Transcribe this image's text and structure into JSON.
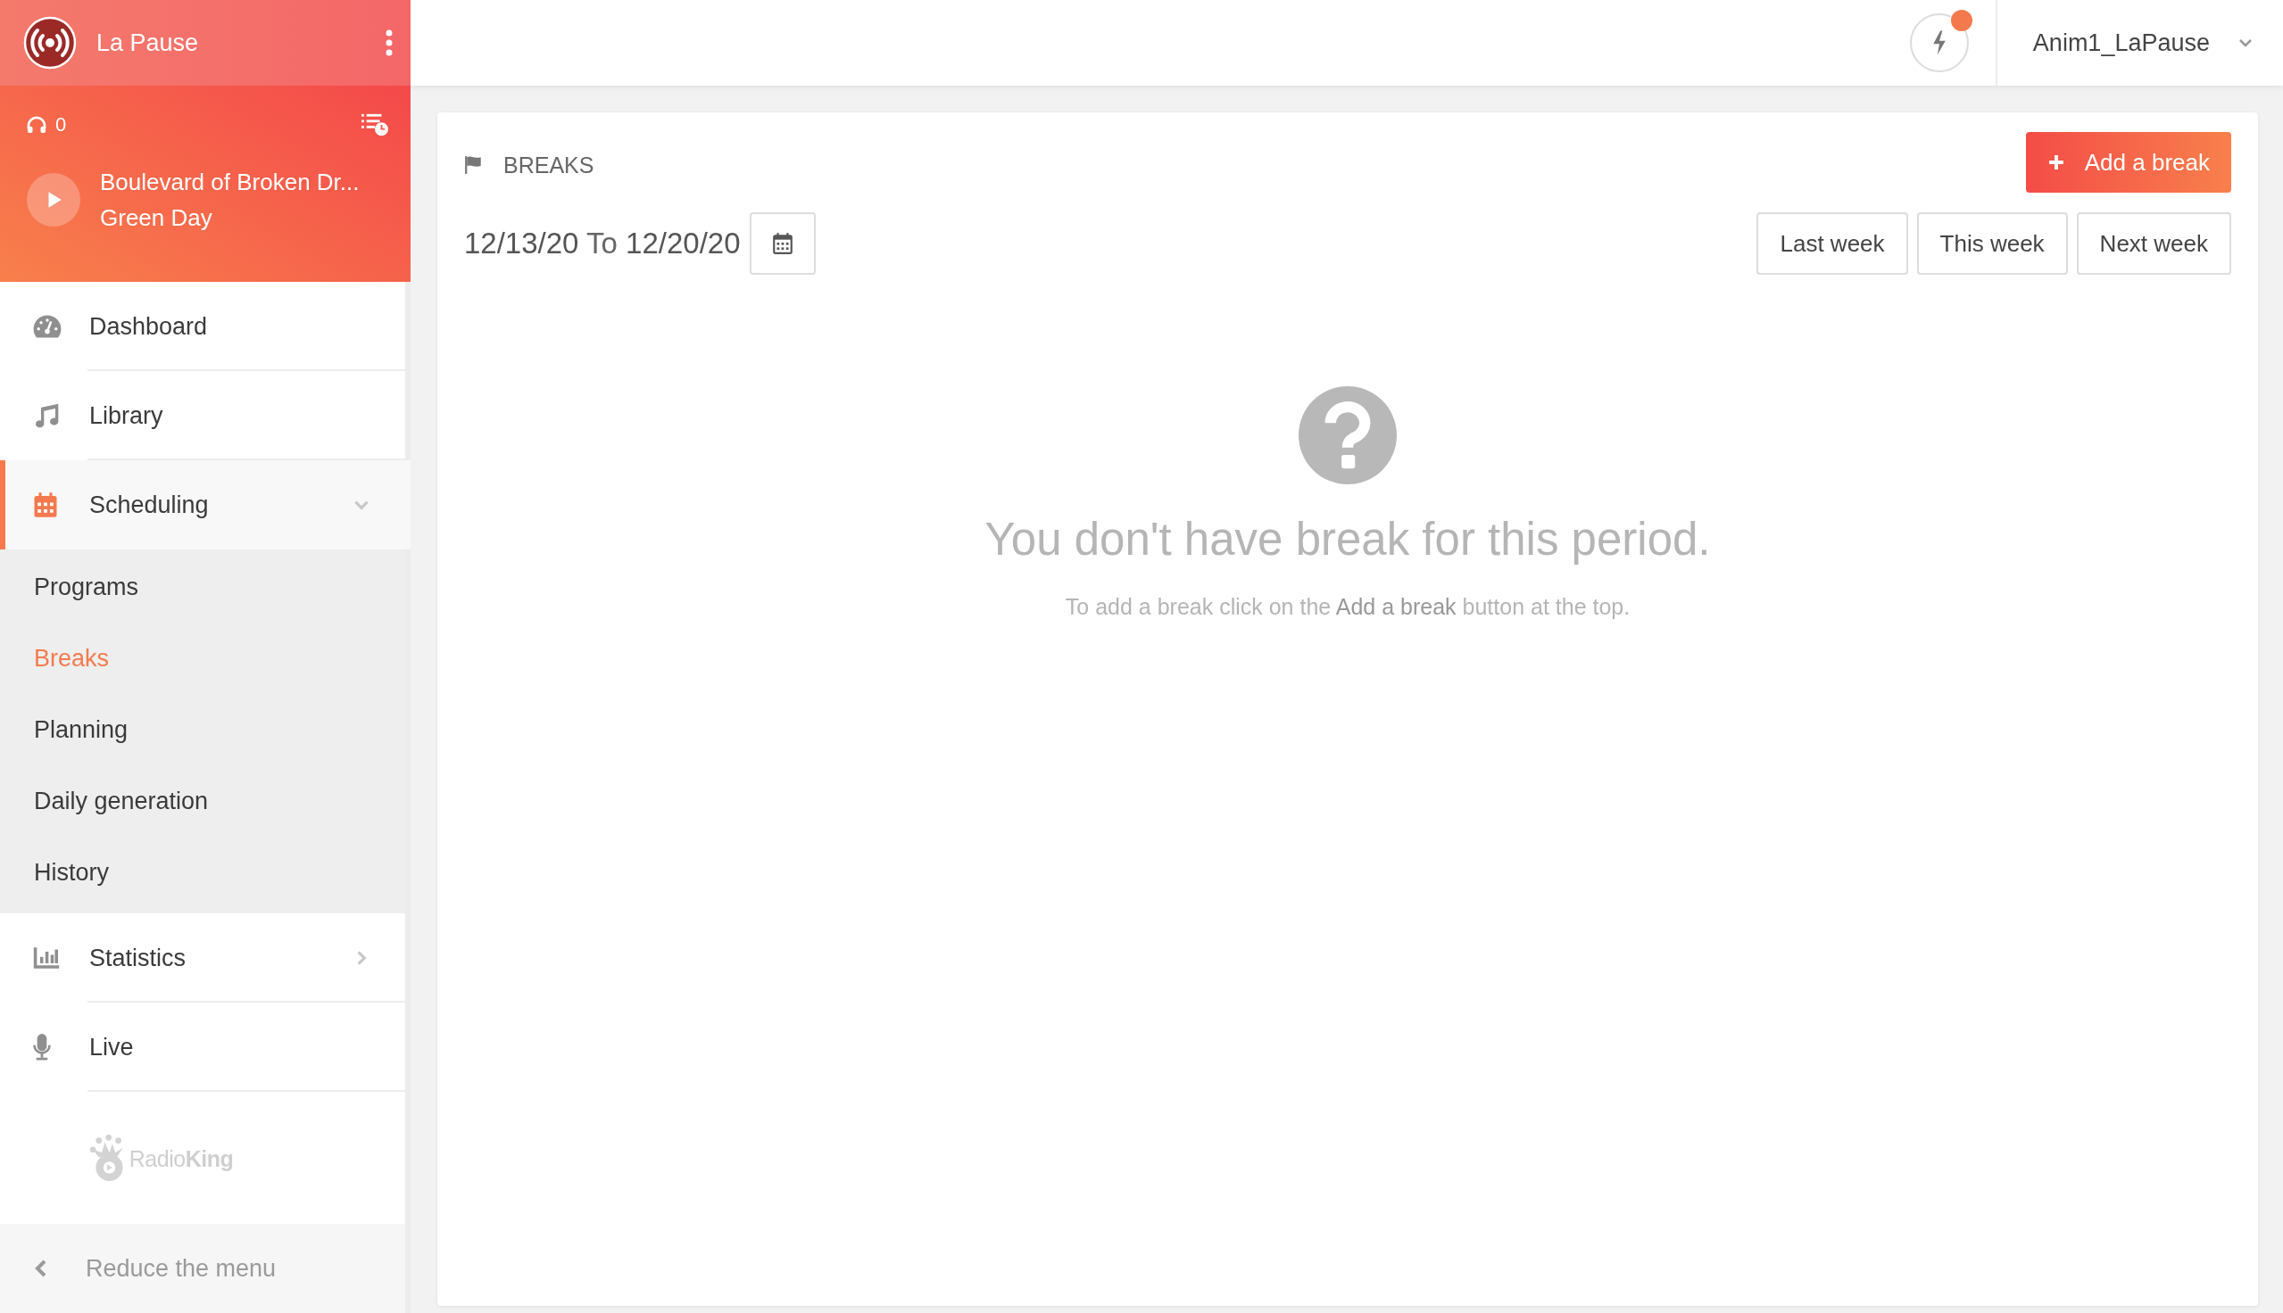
{
  "station": {
    "name": "La Pause"
  },
  "player": {
    "listeners": "0",
    "track": "Boulevard of Broken Dr...",
    "artist": "Green Day"
  },
  "nav": [
    {
      "label": "Dashboard",
      "kind": "link",
      "selected": false
    },
    {
      "label": "Library",
      "kind": "link",
      "selected": false
    },
    {
      "label": "Scheduling",
      "kind": "group",
      "selected": true,
      "expanded": true,
      "children": [
        {
          "label": "Programs",
          "selected": false
        },
        {
          "label": "Breaks",
          "selected": true
        },
        {
          "label": "Planning",
          "selected": false
        },
        {
          "label": "Daily generation",
          "selected": false
        },
        {
          "label": "History",
          "selected": false
        }
      ]
    },
    {
      "label": "Statistics",
      "kind": "group",
      "selected": false,
      "expanded": false
    },
    {
      "label": "Live",
      "kind": "link",
      "selected": false
    }
  ],
  "brand": {
    "logo_text": "Radio**King**"
  },
  "collapse": {
    "label": "Reduce the menu"
  },
  "topbar": {
    "notifications": {
      "unread": true
    },
    "user": "Anim1_LaPause"
  },
  "page": {
    "title": "BREAKS",
    "add_button": "Add a break",
    "date_range": "**12/13/20** To **12/20/20**",
    "period_buttons": [
      {
        "label": "Last week",
        "selected": false
      },
      {
        "label": "This week",
        "selected": false
      },
      {
        "label": "Next week",
        "selected": false
      }
    ],
    "empty": {
      "title": "You don't have break for this period.",
      "hint": "To add a break click on the **Add a break** button at the top."
    }
  }
}
